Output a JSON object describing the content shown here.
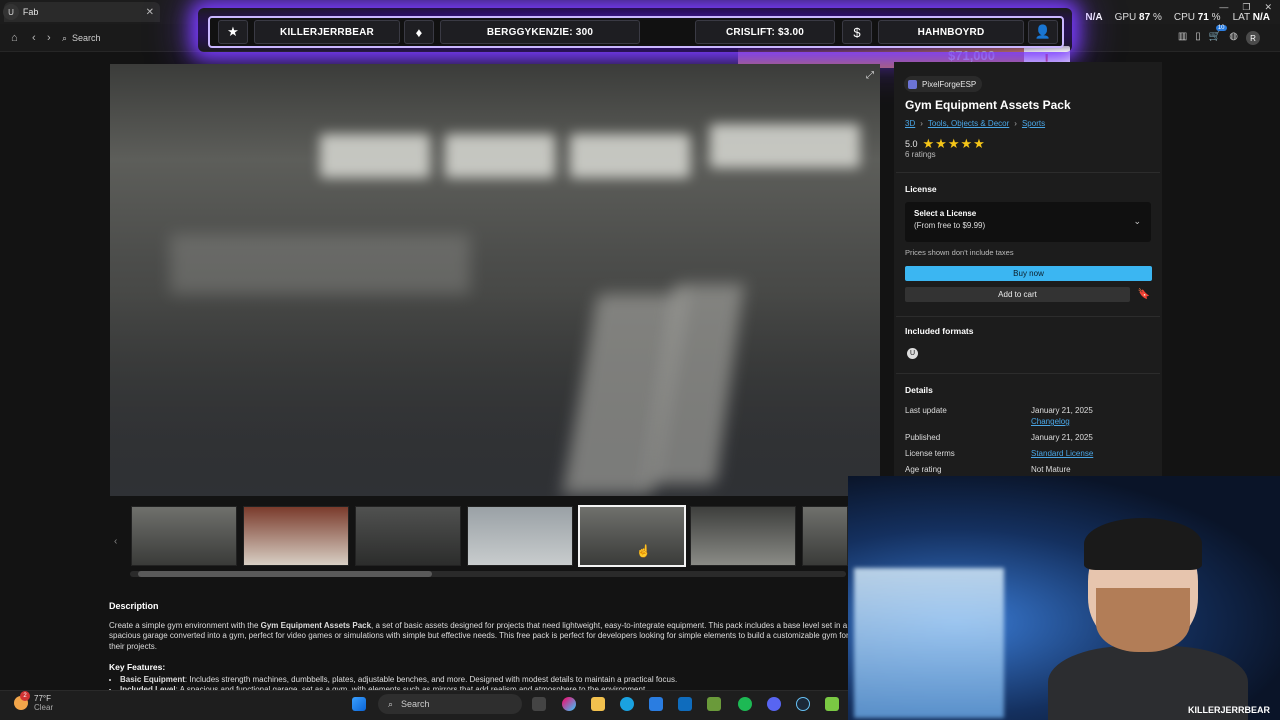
{
  "browser": {
    "tab_title": "Fab",
    "search_placeholder": "Search",
    "avatar_letter": "R"
  },
  "overlay": {
    "left_name": "KILLERJERRBEAR",
    "donation": "BERGGYKENZIE: 300",
    "tip": "CRISLIFT: $3.00",
    "right_name": "HAHNBOYRD"
  },
  "system": {
    "gpu_label": "GPU",
    "gpu_value": "87",
    "cpu_label": "CPU",
    "cpu_value": "71",
    "lat_label": "LAT",
    "lat_value": "N/A",
    "fps_value": "N/A",
    "pct": "%",
    "badge": "10"
  },
  "product": {
    "seller": "PixelForgeESP",
    "title": "Gym Equipment Assets Pack",
    "crumbs": [
      "3D",
      "Tools, Objects & Decor",
      "Sports"
    ],
    "rating_value": "5.0",
    "stars": "★★★★★",
    "ratings_count": "6 ratings"
  },
  "license": {
    "heading": "License",
    "select_title": "Select a License",
    "select_sub": "(From free to $9.99)",
    "taxes_note": "Prices shown don't include taxes",
    "buy_label": "Buy now",
    "cart_label": "Add to cart"
  },
  "formats": {
    "heading": "Included formats",
    "icon_letter": "U"
  },
  "details": {
    "heading": "Details",
    "last_update_label": "Last update",
    "last_update_value": "January 21, 2025",
    "changelog": "Changelog",
    "published_label": "Published",
    "published_value": "January 21, 2025",
    "license_terms_label": "License terms",
    "license_terms_value": "Standard License",
    "age_label": "Age rating",
    "age_value": "Not Mature"
  },
  "description": {
    "heading": "Description",
    "p1_start": "Create a simple gym environment with the ",
    "p1_bold": "Gym Equipment Assets Pack",
    "p1_end": ", a set of basic assets designed for projects that need lightweight, easy-to-integrate equipment. This pack includes a base level set in a spacious garage converted into a gym, perfect for video games or simulations with simple but effective needs. This free pack is perfect for developers looking for simple elements to build a customizable gym for their projects.",
    "key_heading": "Key Features:",
    "f1_bold": "Basic Equipment",
    "f1_text": ": Includes strength machines, dumbbells, plates, adjustable benches, and more. Designed with modest details to maintain a practical focus.",
    "f2_bold": "Included Level",
    "f2_text": ": A spacious and functional garage, set as a gym, with elements such as mirrors that add realism and atmosphere to the environment."
  },
  "promo": {
    "amount": "$71,000",
    "card_glyph": "!"
  },
  "webcam": {
    "name": "KILLERJERRBEAR"
  },
  "taskbar": {
    "temp": "77°F",
    "condition": "Clear",
    "weather_badge": "2",
    "search_label": "Search"
  }
}
